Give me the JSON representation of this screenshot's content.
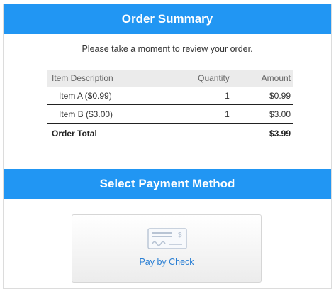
{
  "order_section": {
    "title": "Order Summary",
    "intro": "Please take a moment to review your order.",
    "columns": {
      "description": "Item Description",
      "quantity": "Quantity",
      "amount": "Amount"
    },
    "items": [
      {
        "description": "Item A ($0.99)",
        "quantity": "1",
        "amount": "$0.99"
      },
      {
        "description": "Item B ($3.00)",
        "quantity": "1",
        "amount": "$3.00"
      }
    ],
    "total": {
      "label": "Order Total",
      "amount": "$3.99"
    }
  },
  "payment_section": {
    "title": "Select Payment Method",
    "options": [
      {
        "label": "Pay by Check",
        "icon": "check-icon"
      }
    ]
  },
  "colors": {
    "accent": "#2196f3",
    "link": "#2a7fd4"
  }
}
